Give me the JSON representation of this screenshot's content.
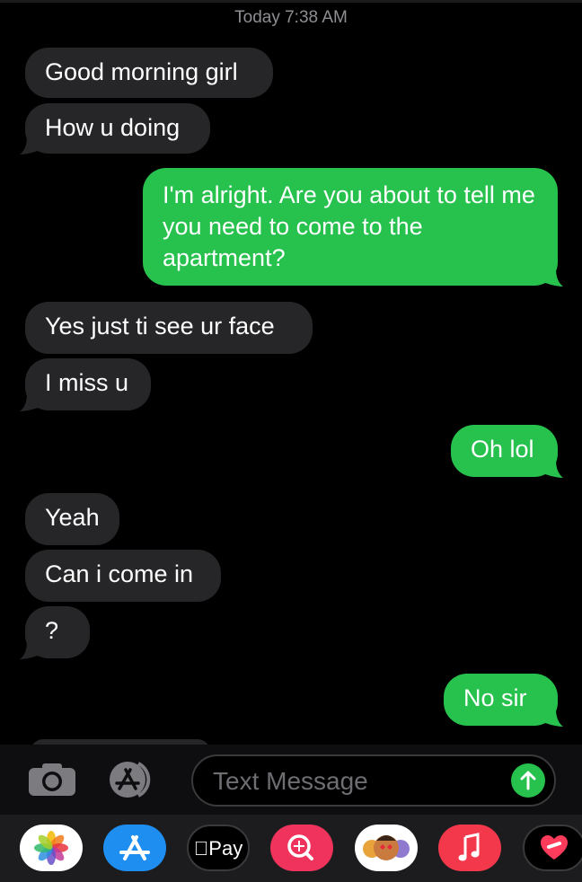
{
  "header": {
    "timestamp": "Today 7:38 AM"
  },
  "messages": [
    {
      "text": "Good morning girl",
      "side": "in"
    },
    {
      "text": "How u doing",
      "side": "in"
    },
    {
      "text": "I'm alright.  Are you about to tell me you need to come to the apartment?",
      "side": "out"
    },
    {
      "text": "Yes just ti see ur face",
      "side": "in"
    },
    {
      "text": "I miss u",
      "side": "in"
    },
    {
      "text": "Oh lol",
      "side": "out"
    },
    {
      "text": "Yeah",
      "side": "in"
    },
    {
      "text": "Can i come in",
      "side": "in"
    },
    {
      "text": "?",
      "side": "in"
    },
    {
      "text": "No sir",
      "side": "out"
    }
  ],
  "colors": {
    "incoming": "#262628",
    "outgoing": "#27c14d",
    "background": "#000000"
  },
  "input": {
    "placeholder": "Text Message"
  },
  "app_drawer": {
    "apps": [
      {
        "name": "photos-icon"
      },
      {
        "name": "app-store-icon"
      },
      {
        "name": "apple-pay-icon",
        "label": "Pay"
      },
      {
        "name": "image-search-icon"
      },
      {
        "name": "memoji-icon"
      },
      {
        "name": "music-icon"
      },
      {
        "name": "digital-touch-icon"
      }
    ]
  }
}
